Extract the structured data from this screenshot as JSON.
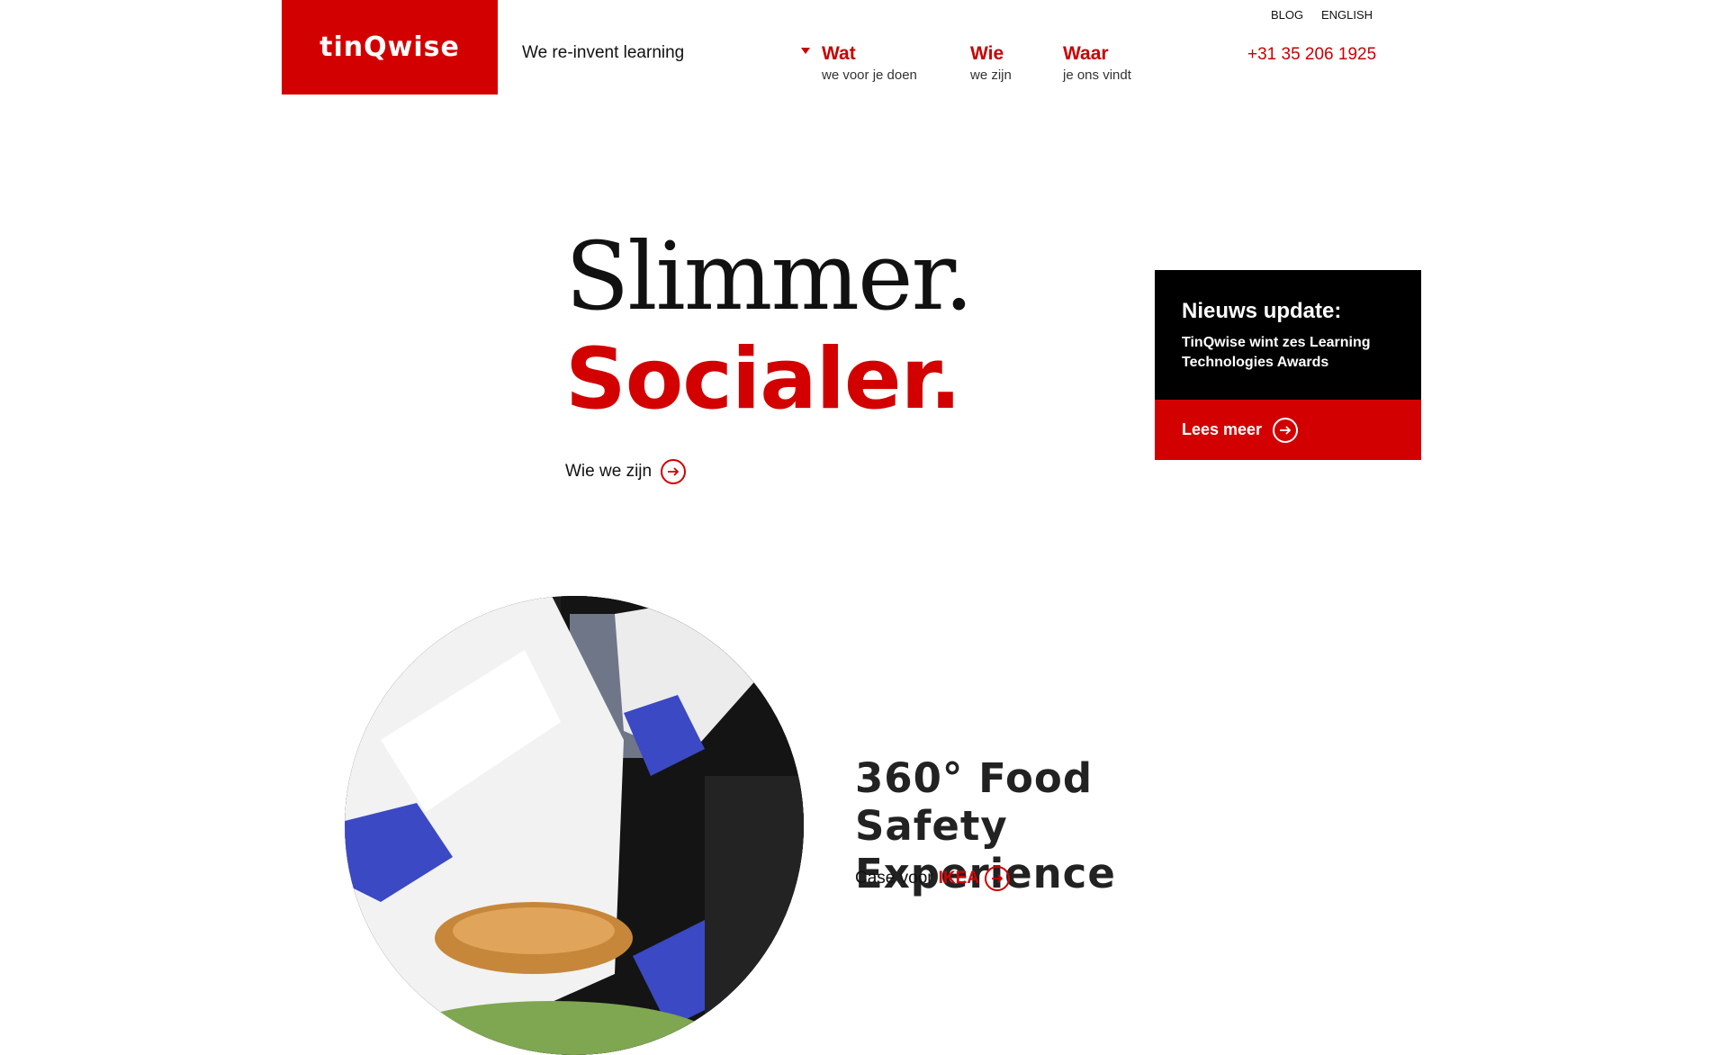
{
  "header": {
    "logo": "tinQwise",
    "tagline": "We re-invent learning",
    "utility_links": [
      "BLOG",
      "ENGLISH"
    ],
    "nav": [
      {
        "title": "Wat",
        "sub": "we voor je doen"
      },
      {
        "title": "Wie",
        "sub": "we zijn"
      },
      {
        "title": "Waar",
        "sub": "je ons vindt"
      }
    ],
    "phone": "+31 35 206 1925"
  },
  "hero": {
    "line1": "Slimmer.",
    "line2": "Socialer.",
    "link_label": "Wie we zijn"
  },
  "news": {
    "title": "Nieuws update:",
    "text": "TinQwise wint zes Learning Technologies Awards",
    "cta": "Lees meer"
  },
  "case": {
    "title": "360° Food Safety Experience",
    "link_prefix": "Case voor",
    "link_brand": "IKEA"
  },
  "colors": {
    "brand_red": "#d30000",
    "black": "#000000"
  }
}
